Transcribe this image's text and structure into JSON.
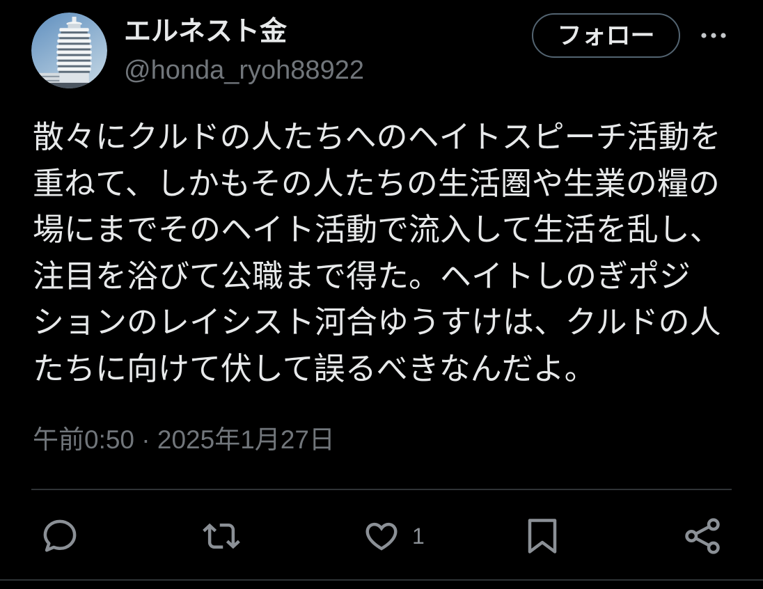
{
  "colors": {
    "background": "#000000",
    "text_primary": "#e7e9ea",
    "text_secondary": "#71767b",
    "divider": "#2f3336",
    "follow_border": "#536471",
    "icon": "#8b9096"
  },
  "post": {
    "author": {
      "avatar_icon": "avatar-image",
      "display_name": "エルネスト金",
      "handle": "@honda_ryoh88922"
    },
    "follow_button_label": "フォロー",
    "more_icon": "more-horizontal-icon",
    "text_lines": [
      "散々にクルドの人たちへのヘイトスピーチ活動を",
      "重ねて、しかもその人たちの生活圏や生業の糧の",
      "場にまでそのヘイト活動で流入して生活を乱し、",
      "注目を浴びて公職まで得た。ヘイトしのぎポジ",
      "ションのレイシスト河合ゆうすけは、クルドの人",
      "たちに向けて伏して誤るべきなんだよ。"
    ],
    "timestamp": "午前0:50 · 2025年1月27日",
    "actions": {
      "reply": {
        "icon": "reply-icon"
      },
      "repost": {
        "icon": "repost-icon"
      },
      "like": {
        "icon": "heart-icon",
        "count": "1"
      },
      "bookmark": {
        "icon": "bookmark-icon"
      },
      "share": {
        "icon": "share-icon"
      }
    }
  }
}
